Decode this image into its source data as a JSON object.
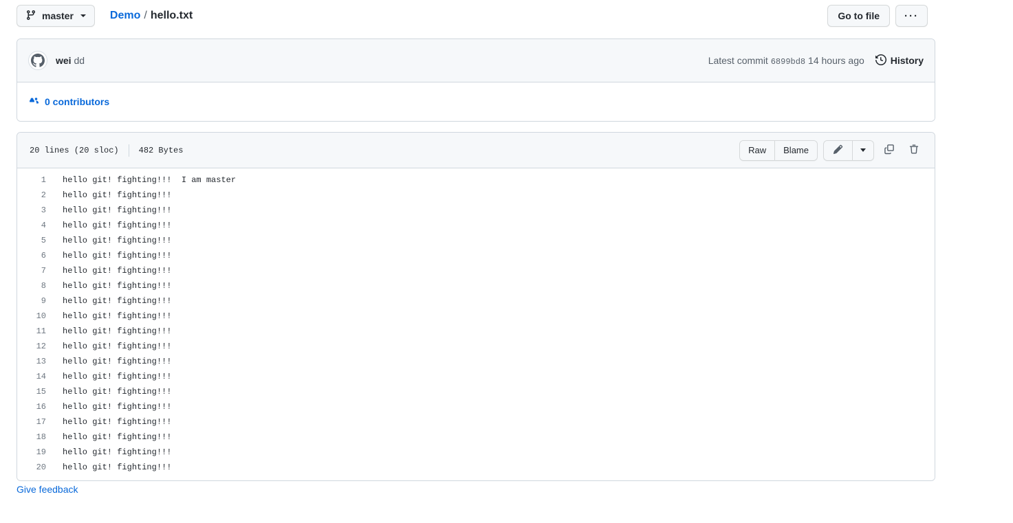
{
  "topbar": {
    "branch_button": {
      "icon": "git-branch-icon",
      "label": "master",
      "caret": "chevron-down-icon"
    },
    "breadcrumb": {
      "repo": "Demo",
      "separator": "/",
      "filename": "hello.txt"
    },
    "go_to_file_label": "Go to file",
    "kebab_label": "···"
  },
  "commit": {
    "avatar_icon": "github-avatar-icon",
    "author": "wei",
    "message": "dd",
    "latest_commit_label": "Latest commit",
    "sha": "6899bd8",
    "time_ago": "14 hours ago",
    "history_label": "History",
    "history_icon": "history-clock-icon"
  },
  "contributors": {
    "icon": "people-icon",
    "label": "0 contributors"
  },
  "file": {
    "lines_label": "20 lines (20 sloc)",
    "size_label": "482 Bytes",
    "actions": {
      "raw_label": "Raw",
      "blame_label": "Blame",
      "edit_icon": "pencil-icon",
      "edit_caret_icon": "chevron-down-icon",
      "copy_icon": "copy-icon",
      "delete_icon": "trash-icon"
    },
    "lines": [
      {
        "number": "1",
        "text": "hello git! fighting!!!  I am master"
      },
      {
        "number": "2",
        "text": "hello git! fighting!!!"
      },
      {
        "number": "3",
        "text": "hello git! fighting!!!"
      },
      {
        "number": "4",
        "text": "hello git! fighting!!!"
      },
      {
        "number": "5",
        "text": "hello git! fighting!!!"
      },
      {
        "number": "6",
        "text": "hello git! fighting!!!"
      },
      {
        "number": "7",
        "text": "hello git! fighting!!!"
      },
      {
        "number": "8",
        "text": "hello git! fighting!!!"
      },
      {
        "number": "9",
        "text": "hello git! fighting!!!"
      },
      {
        "number": "10",
        "text": "hello git! fighting!!!"
      },
      {
        "number": "11",
        "text": "hello git! fighting!!!"
      },
      {
        "number": "12",
        "text": "hello git! fighting!!!"
      },
      {
        "number": "13",
        "text": "hello git! fighting!!!"
      },
      {
        "number": "14",
        "text": "hello git! fighting!!!"
      },
      {
        "number": "15",
        "text": "hello git! fighting!!!"
      },
      {
        "number": "16",
        "text": "hello git! fighting!!!"
      },
      {
        "number": "17",
        "text": "hello git! fighting!!!"
      },
      {
        "number": "18",
        "text": "hello git! fighting!!!"
      },
      {
        "number": "19",
        "text": "hello git! fighting!!!"
      },
      {
        "number": "20",
        "text": "hello git! fighting!!!"
      }
    ]
  },
  "footer": {
    "feedback_label": "Give feedback"
  },
  "colors": {
    "link": "#0969da",
    "text": "#24292f",
    "muted": "#57606a",
    "border": "#d0d7de",
    "surface": "#f6f8fa",
    "background": "#ffffff"
  }
}
